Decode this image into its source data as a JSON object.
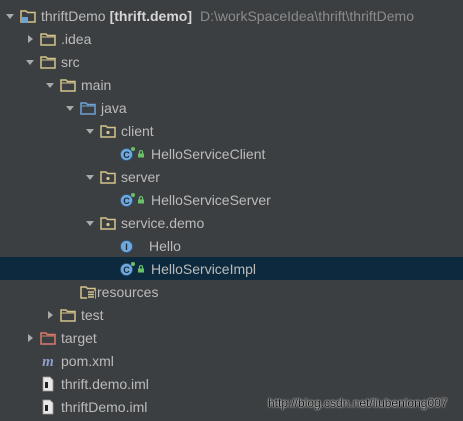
{
  "colors": {
    "background": "#3c3f41",
    "selection": "#0d293e",
    "text": "#bbbbbb",
    "path_text": "#8c8c8c",
    "folder": "#d4c48c",
    "source_folder": "#6fa3d6",
    "excluded_folder": "#d97a6b",
    "class_icon": "#6fa8dc",
    "lock": "#6abf69"
  },
  "project": {
    "name": "thriftDemo",
    "module": "[thrift.demo]",
    "path": "D:\\workSpaceIdea\\thrift\\thriftDemo"
  },
  "tree": [
    {
      "label": "thriftDemo",
      "expanded": true,
      "icon": "project-folder-icon"
    },
    {
      "label": ".idea",
      "expanded": false,
      "icon": "folder-icon"
    },
    {
      "label": "src",
      "expanded": true,
      "icon": "folder-icon"
    },
    {
      "label": "main",
      "expanded": true,
      "icon": "folder-icon"
    },
    {
      "label": "java",
      "expanded": true,
      "icon": "source-folder-icon"
    },
    {
      "label": "client",
      "expanded": true,
      "icon": "package-folder-icon"
    },
    {
      "label": "HelloServiceClient",
      "icon": "java-class-icon"
    },
    {
      "label": "server",
      "expanded": true,
      "icon": "package-folder-icon"
    },
    {
      "label": "HelloServiceServer",
      "icon": "java-class-icon"
    },
    {
      "label": "service.demo",
      "expanded": true,
      "icon": "package-folder-icon"
    },
    {
      "label": "Hello",
      "icon": "java-interface-icon"
    },
    {
      "label": "HelloServiceImpl",
      "icon": "java-class-icon",
      "selected": true
    },
    {
      "label": "resources",
      "icon": "resources-folder-icon"
    },
    {
      "label": "test",
      "expanded": false,
      "icon": "folder-icon"
    },
    {
      "label": "target",
      "expanded": false,
      "icon": "excluded-folder-icon"
    },
    {
      "label": "pom.xml",
      "icon": "maven-icon"
    },
    {
      "label": "thrift.demo.iml",
      "icon": "iml-file-icon"
    },
    {
      "label": "thriftDemo.iml",
      "icon": "iml-file-icon"
    }
  ],
  "watermark": "http://blog.csdn.net/liubenlong007"
}
